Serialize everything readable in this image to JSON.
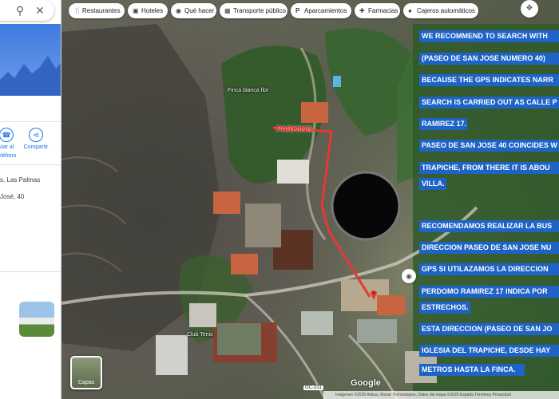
{
  "sidebar": {
    "search_icon": "search-icon",
    "close_icon": "close-icon",
    "actions": [
      {
        "label_line1": "viar al",
        "label_line2": "teléfono",
        "icon": "phone-icon"
      },
      {
        "label_line1": "Compartir",
        "label_line2": "",
        "icon": "share-icon"
      }
    ],
    "address_line1": "s, Las Palmas",
    "address_line2": "José, 40"
  },
  "chips": [
    {
      "label": "Restaurantes",
      "icon": "fork-knife-icon"
    },
    {
      "label": "Hoteles",
      "icon": "bed-icon"
    },
    {
      "label": "Qué hacer",
      "icon": "camera-icon"
    },
    {
      "label": "Transporte público",
      "icon": "bus-icon"
    },
    {
      "label": "Aparcamientos",
      "icon": "parking-icon"
    },
    {
      "label": "Farmacias",
      "icon": "pharmacy-icon"
    },
    {
      "label": "Cajeros automáticos",
      "icon": "atm-icon"
    }
  ],
  "overlay_lines": [
    "WE RECOMMEND  TO SEARCH WITH",
    "(PASEO DE SAN JOSE NUMERO 40)",
    "BECAUSE THE GPS INDICATES NARR",
    "SEARCH IS CARRIED OUT AS CALLE P",
    "RAMIREZ 17.",
    "PASEO DE SAN JOSE 40 COINCIDES W",
    "TRAPICHE, FROM THERE IT IS ABOU",
    "VILLA.",
    "RECOMENDAMOS REALIZAR LA BUS",
    "DIRECCION PASEO DE SAN JOSE NU",
    "GPS SI UTILAZAMOS LA DIRECCION",
    "PERDOMO RAMIREZ 17 INDICA POR",
    "ESTRECHOS.",
    "ESTA DIRECCION (PASEO DE SAN JO",
    "IGLESIA DEL TRAPICHE, DESDE HAY",
    "METROS HASTA LA FINCA."
  ],
  "map": {
    "parking_label": "PARKING",
    "poi_finca": "Finca blanca flor",
    "poi_club": "Club Tenis",
    "layers_label": "Capas",
    "google_logo": "Google",
    "road_badge": "GC-331",
    "attribution": "Imágenes ©2025 Airbus, Maxar Technologies, Datos del mapa ©2025   España   Términos   Privacidad",
    "route_color": "#e53935"
  }
}
